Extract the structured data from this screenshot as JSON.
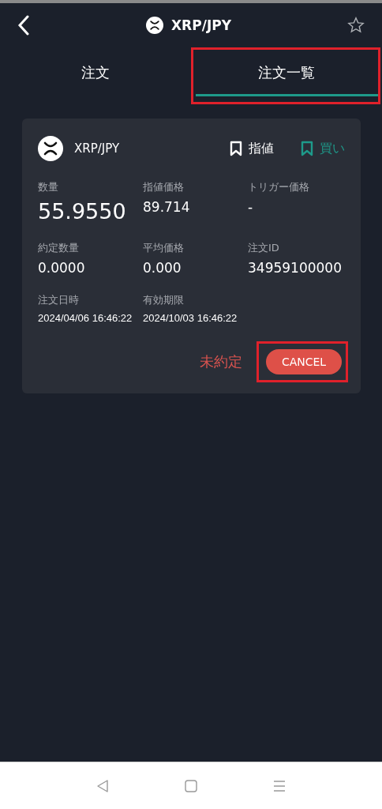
{
  "header": {
    "title": "XRP/JPY",
    "favorite": false
  },
  "tabs": [
    {
      "label": "注文",
      "selected": false,
      "highlighted": false
    },
    {
      "label": "注文一覧",
      "selected": true,
      "highlighted": true
    }
  ],
  "order": {
    "pair": "XRP/JPY",
    "order_type": "指値",
    "side": "買い",
    "fields": [
      {
        "label": "数量",
        "value": "55.9550",
        "kind": "large"
      },
      {
        "label": "指値価格",
        "value": "89.714",
        "kind": "normal"
      },
      {
        "label": "トリガー価格",
        "value": "-",
        "kind": "normal"
      },
      {
        "label": "約定数量",
        "value": "0.0000",
        "kind": "normal"
      },
      {
        "label": "平均価格",
        "value": "0.000",
        "kind": "normal"
      },
      {
        "label": "注文ID",
        "value": "34959100000",
        "kind": "normal"
      },
      {
        "label": "注文日時",
        "value": "2024/04/06 16:46:22",
        "kind": "small"
      },
      {
        "label": "有効期限",
        "value": "2024/10/03 16:46:22",
        "kind": "small"
      }
    ],
    "status": "未約定",
    "cancel": {
      "label": "CANCEL",
      "highlighted": true
    }
  }
}
